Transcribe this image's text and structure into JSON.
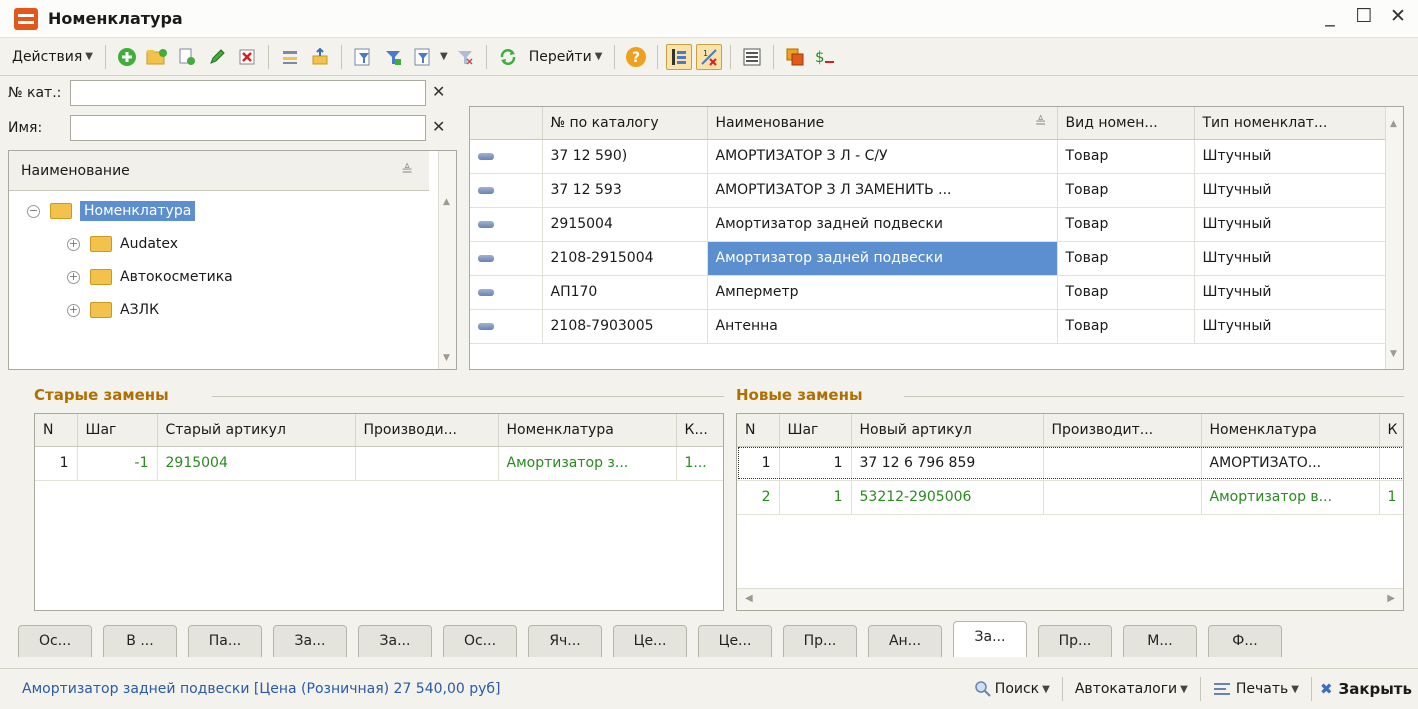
{
  "window": {
    "title": "Номенклатура",
    "controls": {
      "minimize": "_",
      "maximize": "☐",
      "close": "✕"
    }
  },
  "toolbar": {
    "actions_label": "Действия",
    "goto_label": "Перейти",
    "icons": [
      "add-icon",
      "add-folder-icon",
      "copy-icon",
      "edit-icon",
      "delete-icon",
      "hierarchy-icon",
      "move-to-folder-icon",
      "filter-icon",
      "filter-by-value-icon",
      "filter-history-icon",
      "filter-clear-icon",
      "refresh-icon",
      "help-icon",
      "tree-view-icon",
      "mark-icon",
      "list-icon",
      "report-icon",
      "price-icon"
    ]
  },
  "filters": {
    "catalog_label": "№ кат.:",
    "catalog_value": "",
    "name_label": "Имя:",
    "name_value": "",
    "clear_glyph": "✕"
  },
  "tree": {
    "header": "Наименование",
    "items": [
      {
        "label": "Номенклатура",
        "level": 0,
        "expanded": true,
        "selected": true
      },
      {
        "label": "Audatex",
        "level": 1,
        "expanded": false,
        "selected": false
      },
      {
        "label": "Автокосметика",
        "level": 1,
        "expanded": false,
        "selected": false
      },
      {
        "label": "АЗЛК",
        "level": 1,
        "expanded": false,
        "selected": false
      }
    ]
  },
  "items_table": {
    "columns": [
      "",
      "№ по каталогу",
      "Наименование",
      "Вид номен...",
      "Тип номенклат..."
    ],
    "rows": [
      {
        "catalog": "37 12 590)",
        "name": "АМОРТИЗАТОР З Л - С/У",
        "kind": "Товар",
        "type": "Штучный"
      },
      {
        "catalog": "37 12 593",
        "name": "АМОРТИЗАТОР З Л ЗАМЕНИТЬ ...",
        "kind": "Товар",
        "type": "Штучный"
      },
      {
        "catalog": "2915004",
        "name": "Амортизатор задней подвески",
        "kind": "Товар",
        "type": "Штучный"
      },
      {
        "catalog": "2108-2915004",
        "name": "Амортизатор задней подвески",
        "kind": "Товар",
        "type": "Штучный"
      },
      {
        "catalog": "АП170",
        "name": "Амперметр",
        "kind": "Товар",
        "type": "Штучный"
      },
      {
        "catalog": "2108-7903005",
        "name": "Антенна",
        "kind": "Товар",
        "type": "Штучный"
      }
    ]
  },
  "old_replacements": {
    "title": "Старые замены",
    "columns": [
      "N",
      "Шаг",
      "Старый артикул",
      "Производи...",
      "Номенклатура",
      "К..."
    ],
    "rows": [
      {
        "n": "1",
        "step": "-1",
        "article": "2915004",
        "maker": "",
        "nomenclature": "Амортизатор з...",
        "k": "1..."
      }
    ]
  },
  "new_replacements": {
    "title": "Новые замены",
    "columns": [
      "N",
      "Шаг",
      "Новый артикул",
      "Производит...",
      "Номенклатура",
      "К"
    ],
    "rows": [
      {
        "n": "1",
        "step": "1",
        "article": "37 12 6 796 859",
        "maker": "",
        "nomenclature": "АМОРТИЗАТО...",
        "k": ""
      },
      {
        "n": "2",
        "step": "1",
        "article": "53212-2905006",
        "maker": "",
        "nomenclature": "Амортизатор в...",
        "k": "1"
      }
    ]
  },
  "tabs": [
    "Ос...",
    "В ...",
    "Па...",
    "За...",
    "За...",
    "Ос...",
    "Яч...",
    "Це...",
    "Це...",
    "Пр...",
    "Ан...",
    "За...",
    "Пр...",
    "М...",
    "Ф..."
  ],
  "active_tab_index": 11,
  "status": {
    "text": "Амортизатор задней подвески [Цена (Розничная) 27 540,00 руб]",
    "search_label": "Поиск",
    "autocatalog_label": "Автокаталоги",
    "print_label": "Печать",
    "close_label": "Закрыть"
  },
  "colors": {
    "selection": "#5c8fd0",
    "group_title": "#b07000",
    "green_text": "#2a8a1f",
    "status_text": "#2a5aa8"
  }
}
